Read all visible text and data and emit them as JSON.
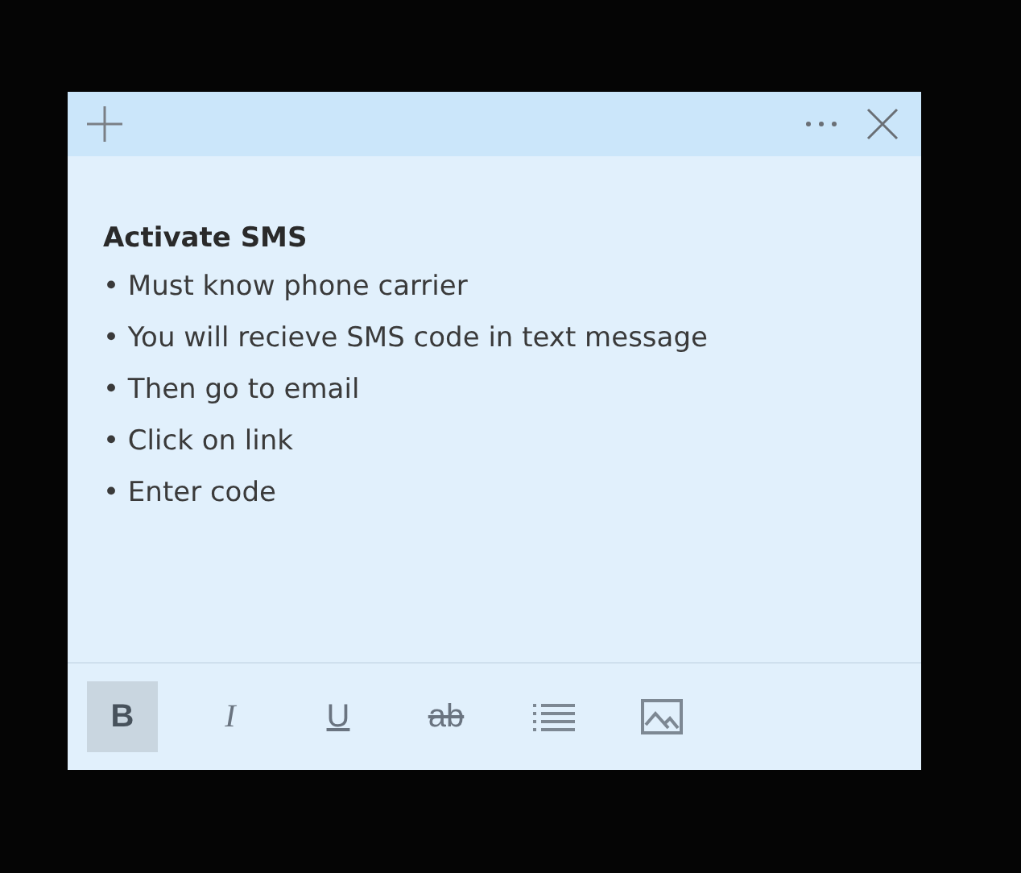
{
  "note": {
    "title": "Activate SMS",
    "lines": [
      "• Must know phone carrier",
      "• You will recieve SMS code in text message",
      "• Then go to email",
      "• Click on link",
      "• Enter code"
    ]
  },
  "toolbar": [
    {
      "kind": "bold",
      "label": "B",
      "selected": true
    },
    {
      "kind": "italic",
      "label": "I",
      "selected": false
    },
    {
      "kind": "underline",
      "label": "U",
      "selected": false
    },
    {
      "kind": "strike",
      "label": "ab",
      "selected": false
    },
    {
      "kind": "list",
      "selected": false
    },
    {
      "kind": "image",
      "selected": false
    }
  ]
}
